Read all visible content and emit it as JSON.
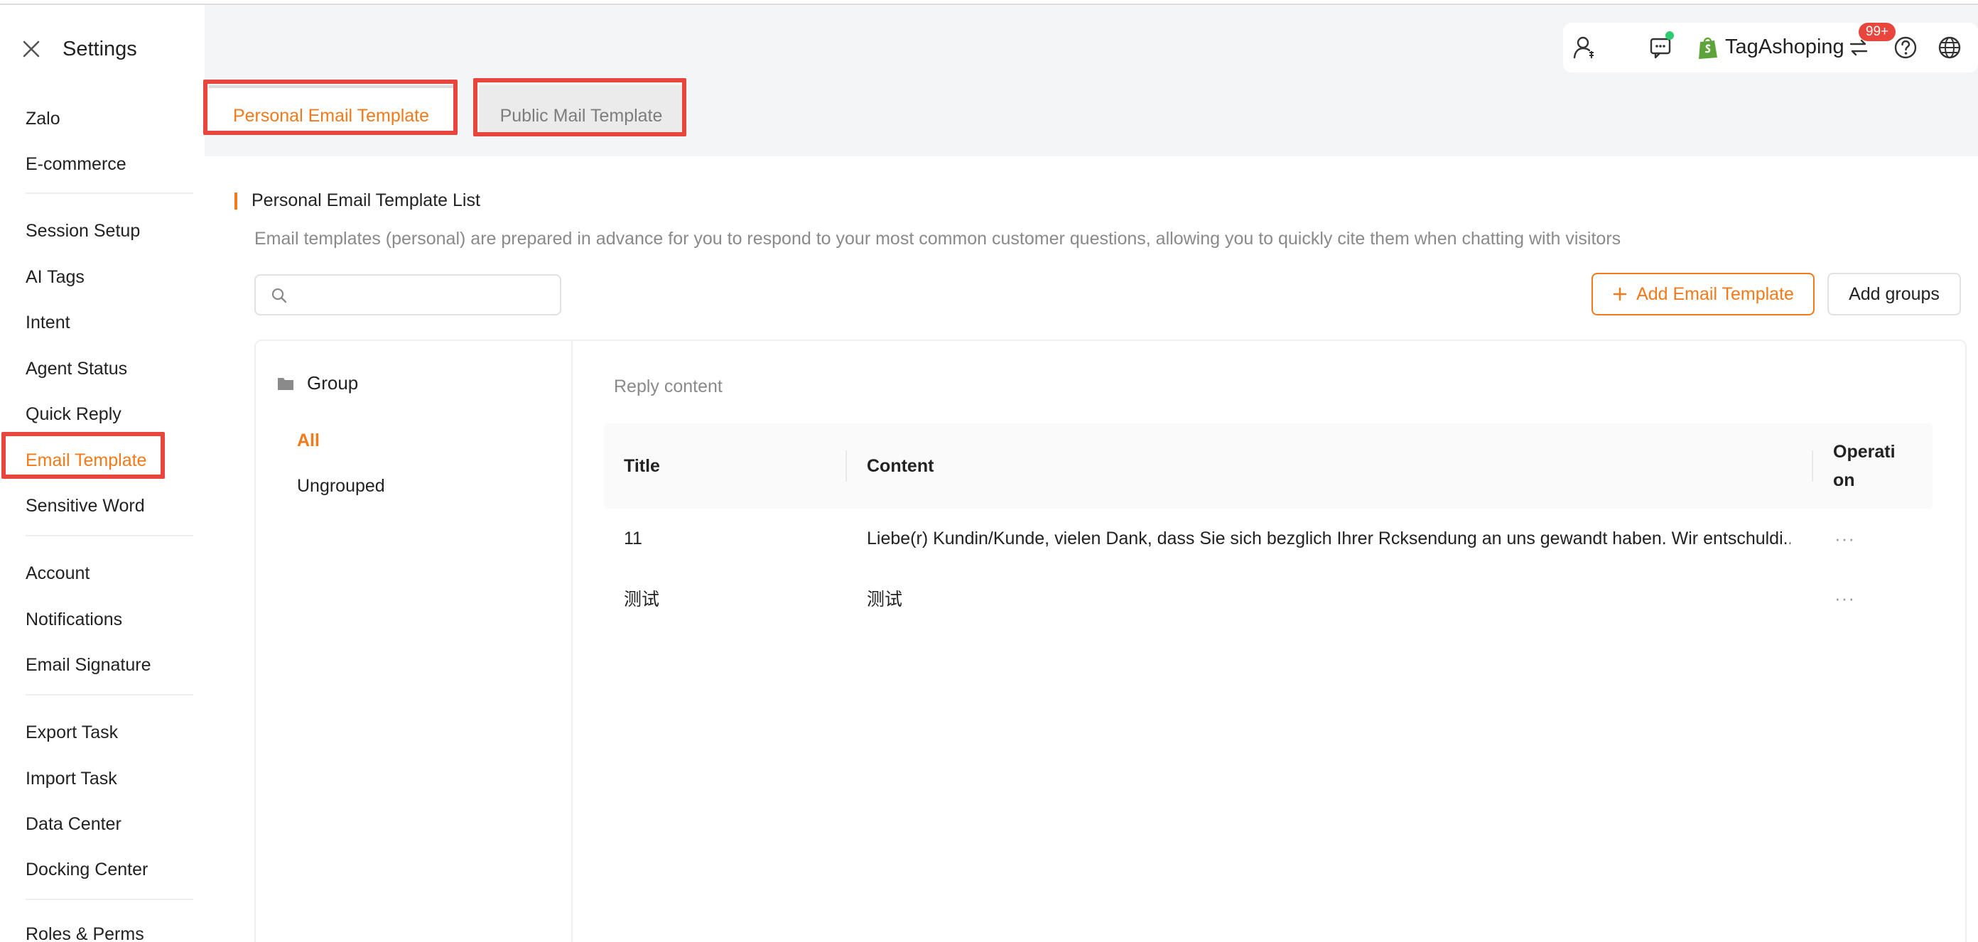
{
  "window": {
    "title": "Settings"
  },
  "toolbar": {
    "shop_name": "TagAshoping",
    "notification_badge": "99+"
  },
  "colors": {
    "accent": "#f27a1a",
    "highlight_box": "#e8453c",
    "online_dot": "#2ecc71"
  },
  "sidebar": {
    "items": [
      {
        "label": "Zalo"
      },
      {
        "label": "E-commerce"
      },
      {
        "label": "Session Setup"
      },
      {
        "label": "AI Tags"
      },
      {
        "label": "Intent"
      },
      {
        "label": "Agent Status"
      },
      {
        "label": "Quick Reply"
      },
      {
        "label": "Email Template"
      },
      {
        "label": "Sensitive Word"
      },
      {
        "label": "Account"
      },
      {
        "label": "Notifications"
      },
      {
        "label": "Email Signature"
      },
      {
        "label": "Export Task"
      },
      {
        "label": "Import Task"
      },
      {
        "label": "Data Center"
      },
      {
        "label": "Docking Center"
      },
      {
        "label": "Roles & Perms"
      }
    ],
    "active": "Email Template"
  },
  "tabs": [
    {
      "label": "Personal Email Template"
    },
    {
      "label": "Public Mail Template"
    }
  ],
  "main": {
    "section_title": "Personal Email Template List",
    "description": "Email templates (personal) are prepared in advance for you to respond to your most common customer questions, allowing you to quickly cite them when chatting with visitors",
    "search": {
      "placeholder": "",
      "value": ""
    },
    "add_button": "Add Email Template",
    "add_groups_button": "Add groups",
    "groups": {
      "header": "Group",
      "items": [
        {
          "label": "All"
        },
        {
          "label": "Ungrouped"
        }
      ],
      "active": "All"
    },
    "reply_title": "Reply content",
    "table": {
      "columns": [
        "Title",
        "Content",
        "Operati\non"
      ],
      "rows": [
        {
          "title": "11",
          "content": "Liebe(r) Kundin/Kunde, vielen Dank, dass Sie sich bezglich Ihrer Rcksendung an uns gewandt haben. Wir entschuldi...",
          "op": "···"
        },
        {
          "title": "测试",
          "content": "测试",
          "op": "···"
        }
      ]
    }
  }
}
